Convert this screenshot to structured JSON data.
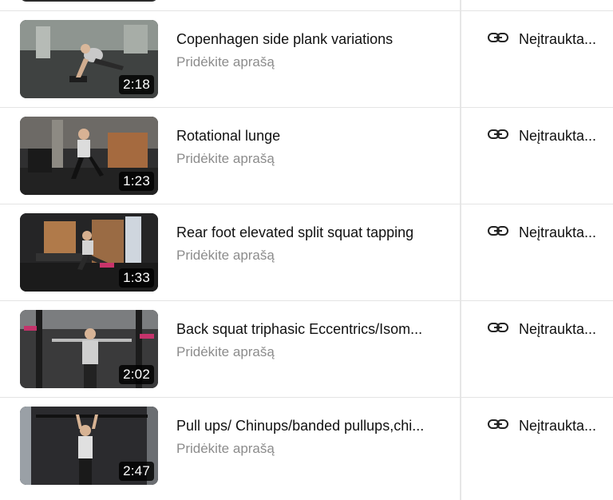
{
  "videos": [
    {
      "title": "Copenhagen side plank variations",
      "description_placeholder": "Pridėkite aprašą",
      "duration": "2:18",
      "visibility": "Neįtraukta..."
    },
    {
      "title": "Rotational lunge",
      "description_placeholder": "Pridėkite aprašą",
      "duration": "1:23",
      "visibility": "Neįtraukta..."
    },
    {
      "title": "Rear foot elevated split squat tapping",
      "description_placeholder": "Pridėkite aprašą",
      "duration": "1:33",
      "visibility": "Neįtraukta..."
    },
    {
      "title": "Back squat triphasic Eccentrics/Isom...",
      "description_placeholder": "Pridėkite aprašą",
      "duration": "2:02",
      "visibility": "Neįtraukta..."
    },
    {
      "title": "Pull ups/ Chinups/banded pullups,chi...",
      "description_placeholder": "Pridėkite aprašą",
      "duration": "2:47",
      "visibility": "Neįtraukta..."
    }
  ],
  "icons": {
    "visibility": "link-icon"
  },
  "colors": {
    "duration_badge_bg": "#000000",
    "description_text": "#8c8c8c",
    "divider": "#e4e4e4"
  }
}
